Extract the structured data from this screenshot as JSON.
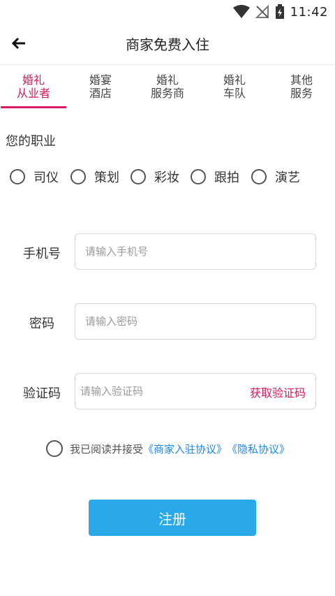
{
  "status_bar": {
    "time": "11:42"
  },
  "header": {
    "title": "商家免费入住"
  },
  "tabs": [
    {
      "line1": "婚礼",
      "line2": "从业者",
      "active": true
    },
    {
      "line1": "婚宴",
      "line2": "酒店",
      "active": false
    },
    {
      "line1": "婚礼",
      "line2": "服务商",
      "active": false
    },
    {
      "line1": "婚礼",
      "line2": "车队",
      "active": false
    },
    {
      "line1": "其他",
      "line2": "服务",
      "active": false
    }
  ],
  "profession": {
    "label": "您的职业",
    "options": [
      "司仪",
      "策划",
      "彩妆",
      "跟拍",
      "演艺"
    ]
  },
  "form": {
    "phone": {
      "label": "手机号",
      "placeholder": "请输入手机号"
    },
    "password": {
      "label": "密码",
      "placeholder": "请输入密码"
    },
    "code": {
      "label": "验证码",
      "placeholder": "请输入验证码",
      "button": "获取验证码"
    }
  },
  "agreement": {
    "text": "我已阅读并接受",
    "link1": "《商家入驻协议》",
    "link2": "《隐私协议》"
  },
  "submit_label": "注册",
  "colors": {
    "accent": "#d81b60",
    "primary_button": "#29a8ea",
    "link": "#1e88e5"
  }
}
